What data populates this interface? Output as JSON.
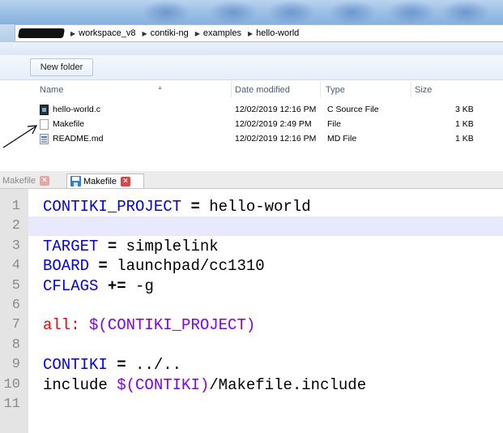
{
  "explorer": {
    "breadcrumb": [
      "workspace_v8",
      "contiki-ng",
      "examples",
      "hello-world"
    ],
    "new_folder_label": "New folder",
    "columns": [
      "Name",
      "Date modified",
      "Type",
      "Size"
    ],
    "files": [
      {
        "name": "hello-world.c",
        "date": "12/02/2019 12:16 PM",
        "type": "C Source File",
        "size": "3 KB",
        "icon": "c-source-file-icon"
      },
      {
        "name": "Makefile",
        "date": "12/02/2019 2:49 PM",
        "type": "File",
        "size": "1 KB",
        "icon": "blank-file-icon"
      },
      {
        "name": "README.md",
        "date": "12/02/2019 12:16 PM",
        "type": "MD File",
        "size": "1 KB",
        "icon": "md-file-icon"
      }
    ]
  },
  "editor": {
    "tabs": [
      {
        "label": "Makefile",
        "active": false
      },
      {
        "label": "Makefile",
        "active": true
      }
    ],
    "lines": [
      {
        "n": "1",
        "parts": [
          {
            "t": "CONTIKI_PROJECT",
            "c": "kw-blue"
          },
          {
            "t": " ",
            "c": ""
          },
          {
            "t": "=",
            "c": "op"
          },
          {
            "t": " hello-world",
            "c": ""
          }
        ]
      },
      {
        "n": "2",
        "parts": [],
        "highlight": true
      },
      {
        "n": "3",
        "parts": [
          {
            "t": "TARGET",
            "c": "kw-blue"
          },
          {
            "t": " ",
            "c": ""
          },
          {
            "t": "=",
            "c": "op"
          },
          {
            "t": " simplelink",
            "c": ""
          }
        ]
      },
      {
        "n": "4",
        "parts": [
          {
            "t": "BOARD",
            "c": "kw-blue"
          },
          {
            "t": " ",
            "c": ""
          },
          {
            "t": "=",
            "c": "op"
          },
          {
            "t": " launchpad/cc1310",
            "c": ""
          }
        ]
      },
      {
        "n": "5",
        "parts": [
          {
            "t": "CFLAGS",
            "c": "kw-blue"
          },
          {
            "t": " ",
            "c": ""
          },
          {
            "t": "+=",
            "c": "op"
          },
          {
            "t": " -g",
            "c": ""
          }
        ]
      },
      {
        "n": "6",
        "parts": []
      },
      {
        "n": "7",
        "parts": [
          {
            "t": "all:",
            "c": "kw-red"
          },
          {
            "t": " ",
            "c": ""
          },
          {
            "t": "$(",
            "c": "purple"
          },
          {
            "t": "CONTIKI_PROJECT",
            "c": "purple"
          },
          {
            "t": ")",
            "c": "purple"
          }
        ]
      },
      {
        "n": "8",
        "parts": []
      },
      {
        "n": "9",
        "parts": [
          {
            "t": "CONTIKI",
            "c": "kw-blue"
          },
          {
            "t": " ",
            "c": ""
          },
          {
            "t": "=",
            "c": "op"
          },
          {
            "t": " ../..",
            "c": ""
          }
        ]
      },
      {
        "n": "10",
        "parts": [
          {
            "t": "include ",
            "c": ""
          },
          {
            "t": "$(",
            "c": "purple"
          },
          {
            "t": "CONTIKI",
            "c": "purple"
          },
          {
            "t": ")",
            "c": "purple"
          },
          {
            "t": "/Makefile.include",
            "c": ""
          }
        ]
      },
      {
        "n": "11",
        "parts": []
      }
    ]
  },
  "colors": {
    "keyword": "#0000ff",
    "target": "#ff0000",
    "variable_ref": "#8000ff",
    "current_line": "#e8e8ff"
  }
}
